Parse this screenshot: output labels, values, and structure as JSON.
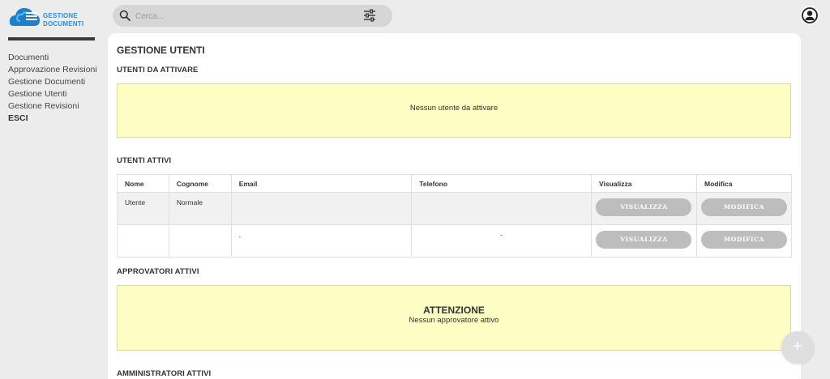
{
  "brand": {
    "line1": "GESTIONE",
    "line2": "DOCUMENTI",
    "color": "#2a8fd6"
  },
  "sidebar": {
    "items": [
      {
        "label": "Documenti"
      },
      {
        "label": "Approvazione Revisioni"
      },
      {
        "label": "Gestione Documenti"
      },
      {
        "label": "Gestione Utenti"
      },
      {
        "label": "Gestione Revisioni"
      },
      {
        "label": "ESCI"
      }
    ]
  },
  "search": {
    "placeholder": "Cerca...",
    "value": ""
  },
  "page": {
    "title": "GESTIONE UTENTI",
    "pending_heading": "UTENTI DA ATTIVARE",
    "pending_message": "Nessun utente da attivare",
    "active_heading": "UTENTI ATTIVI",
    "approvers_heading": "APPROVATORI ATTIVI",
    "approvers_title": "ATTENZIONE",
    "approvers_message": "Nessun approvatore attivo",
    "admins_heading": "AMMINISTRATORI ATTIVI"
  },
  "table": {
    "headers": [
      "Nome",
      "Cognome",
      "Email",
      "Telefono",
      "Visualizza",
      "Modifica"
    ],
    "rows": [
      {
        "nome": "Utente",
        "cognome": "Normale",
        "email": "",
        "telefono": "",
        "view": "VISUALIZZA",
        "edit": "MODIFICA"
      },
      {
        "nome": "",
        "cognome": "",
        "email": ",",
        "telefono": "-",
        "view": "VISUALIZZA",
        "edit": "MODIFICA"
      }
    ]
  },
  "fab": {
    "label": "+"
  },
  "colors": {
    "notice_bg": "#fdfdc4",
    "button_bg": "#bdbdbd",
    "background": "#ececec"
  }
}
